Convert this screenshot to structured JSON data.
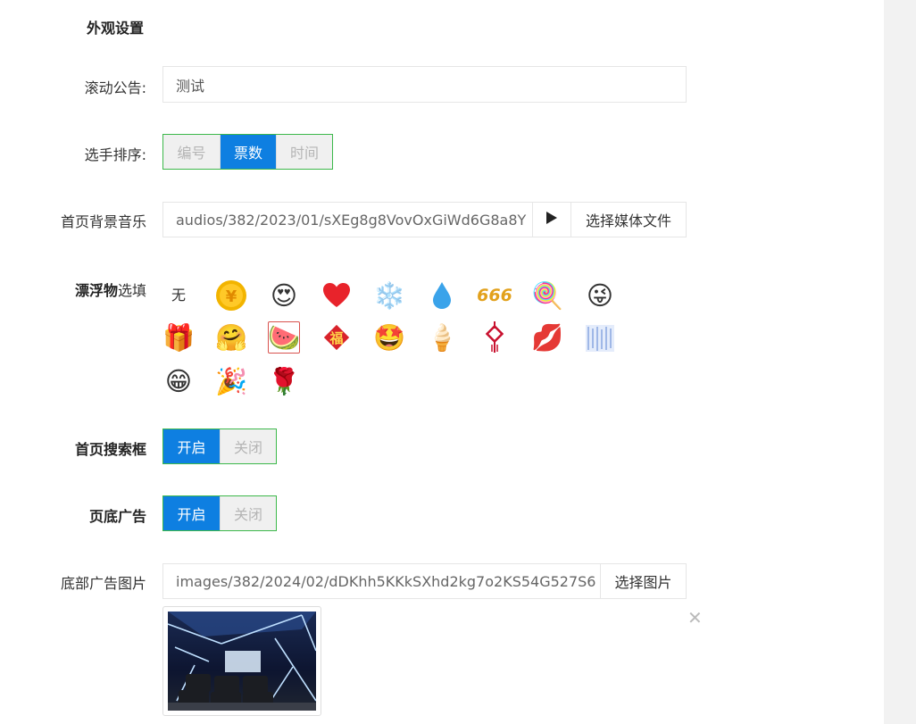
{
  "section_title": "外观设置",
  "scroll_notice": {
    "label": "滚动公告:",
    "value": "测试"
  },
  "sort": {
    "label": "选手排序:",
    "options": [
      "编号",
      "票数",
      "时间"
    ],
    "active_index": 1
  },
  "bg_music": {
    "label": "首页背景音乐",
    "value": "audios/382/2023/01/sXEg8g8VovOxGiWd6G8a8Y",
    "play_icon": "play-icon",
    "choose_label": "选择媒体文件"
  },
  "floaters": {
    "label_bold": "漂浮物",
    "label_rest": "选填",
    "none_label": "无",
    "items": [
      "coin",
      "love-face",
      "heart",
      "snowflake",
      "droplet",
      "666",
      "lollipop",
      "wink",
      "gift",
      "hug",
      "watermelon",
      "fu",
      "star-eyes",
      "ice-cream",
      "chinese-knot",
      "lips",
      "snow-pattern",
      "grin",
      "party-popper",
      "rose"
    ],
    "selected": "watermelon"
  },
  "search_box": {
    "label": "首页搜索框",
    "options": [
      "开启",
      "关闭"
    ],
    "active_index": 0
  },
  "footer_ad": {
    "label": "页底广告",
    "options": [
      "开启",
      "关闭"
    ],
    "active_index": 0
  },
  "ad_image": {
    "label": "底部广告图片",
    "value": "images/382/2024/02/dDKhh5KKkSXhd2kg7o2KS54G527S6",
    "choose_label": "选择图片",
    "remove_icon": "close-icon"
  },
  "colors": {
    "accent": "#0e7fe1",
    "segment_border": "#3cb84a",
    "selected_border": "#d9534f"
  }
}
